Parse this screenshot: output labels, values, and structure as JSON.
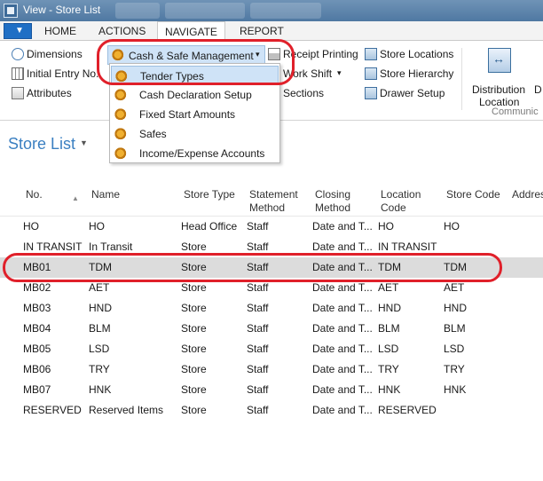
{
  "window": {
    "title": "View - Store List"
  },
  "tabs": {
    "home": "HOME",
    "actions": "ACTIONS",
    "navigate": "NAVIGATE",
    "report": "REPORT"
  },
  "ribbon": {
    "dimensions": "Dimensions",
    "initial_entry": "Initial Entry No.",
    "attributes": "Attributes",
    "cash_safe": "Cash & Safe Management",
    "receipt_printing": "Receipt Printing",
    "work_shift": "Work Shift",
    "sections": "Sections",
    "store_locations": "Store Locations",
    "store_hierarchy": "Store Hierarchy",
    "drawer_setup": "Drawer Setup",
    "distribution_line1": "Distribution",
    "distribution_line2": "Location",
    "cut_letter": "D",
    "group_label": "Communic"
  },
  "dropdown": {
    "items": [
      "Tender Types",
      "Cash Declaration Setup",
      "Fixed Start Amounts",
      "Safes",
      "Income/Expense Accounts"
    ]
  },
  "page": {
    "title": "Store List"
  },
  "table": {
    "headers": {
      "no": "No.",
      "name": "Name",
      "store_type": "Store Type",
      "statement_1": "Statement",
      "statement_2": "Method",
      "closing_1": "Closing",
      "closing_2": "Method",
      "location_1": "Location",
      "location_2": "Code",
      "store_code": "Store Code",
      "address": "Addres"
    },
    "rows": [
      {
        "no": "HO",
        "name": "HO",
        "type": "Head Office",
        "stmt": "Staff",
        "closing": "Date and T...",
        "loc": "HO",
        "code": "HO"
      },
      {
        "no": "IN TRANSIT",
        "name": "In Transit",
        "type": "Store",
        "stmt": "Staff",
        "closing": "Date and T...",
        "loc": "IN TRANSIT",
        "code": ""
      },
      {
        "no": "MB01",
        "name": "TDM",
        "type": "Store",
        "stmt": "Staff",
        "closing": "Date and T...",
        "loc": "TDM",
        "code": "TDM"
      },
      {
        "no": "MB02",
        "name": "AET",
        "type": "Store",
        "stmt": "Staff",
        "closing": "Date and T...",
        "loc": "AET",
        "code": "AET"
      },
      {
        "no": "MB03",
        "name": "HND",
        "type": "Store",
        "stmt": "Staff",
        "closing": "Date and T...",
        "loc": "HND",
        "code": "HND"
      },
      {
        "no": "MB04",
        "name": "BLM",
        "type": "Store",
        "stmt": "Staff",
        "closing": "Date and T...",
        "loc": "BLM",
        "code": "BLM"
      },
      {
        "no": "MB05",
        "name": "LSD",
        "type": "Store",
        "stmt": "Staff",
        "closing": "Date and T...",
        "loc": "LSD",
        "code": "LSD"
      },
      {
        "no": "MB06",
        "name": "TRY",
        "type": "Store",
        "stmt": "Staff",
        "closing": "Date and T...",
        "loc": "TRY",
        "code": "TRY"
      },
      {
        "no": "MB07",
        "name": "HNK",
        "type": "Store",
        "stmt": "Staff",
        "closing": "Date and T...",
        "loc": "HNK",
        "code": "HNK"
      },
      {
        "no": "RESERVED",
        "name": "Reserved Items",
        "type": "Store",
        "stmt": "Staff",
        "closing": "Date and T...",
        "loc": "RESERVED",
        "code": ""
      }
    ]
  },
  "colors": {
    "accent": "#3a7fc1",
    "highlight": "#cfe3f7",
    "annotation": "#e0202a",
    "selected_row": "#dcdcdc"
  }
}
